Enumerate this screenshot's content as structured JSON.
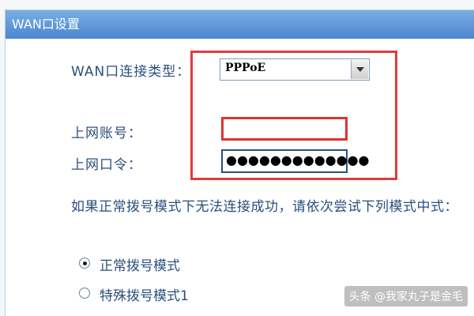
{
  "panel": {
    "title": "WAN口设置"
  },
  "form": {
    "conn_type_label": "WAN口连接类型：",
    "conn_type_value": "PPPoE",
    "account_label": "上网账号：",
    "account_value": "",
    "password_label": "上网口令：",
    "password_mask": "●●●●●●●●●●●●●"
  },
  "hint": {
    "text": "如果正常拨号模式下无法连接成功，请依次尝试下列模式中式："
  },
  "modes": [
    {
      "label": "正常拨号模式",
      "checked": true
    },
    {
      "label": "特殊拨号模式1",
      "checked": false
    }
  ],
  "watermark": {
    "text": "头条 @我家丸子是金毛"
  },
  "colors": {
    "header": "#4b86cf",
    "label": "#2a4f7a",
    "highlight": "#e53a3a"
  }
}
